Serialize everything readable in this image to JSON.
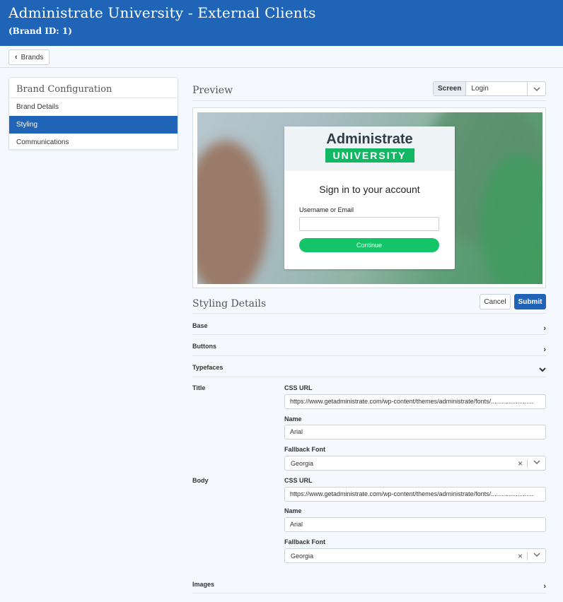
{
  "header": {
    "title": "Administrate University - External Clients",
    "subtitle": "(Brand ID: 1)"
  },
  "topbar": {
    "back_label": "Brands"
  },
  "sidebar": {
    "title": "Brand Configuration",
    "items": [
      {
        "label": "Brand Details",
        "active": false
      },
      {
        "label": "Styling",
        "active": true
      },
      {
        "label": "Communications",
        "active": false
      }
    ]
  },
  "preview": {
    "title": "Preview",
    "screen_label": "Screen",
    "screen_value": "Login",
    "card": {
      "logo_word": "Administrate",
      "logo_band": "UNIVERSITY",
      "heading": "Sign in to your account",
      "field_label": "Username or Email",
      "button": "Continue"
    }
  },
  "styling": {
    "title": "Styling Details",
    "cancel_label": "Cancel",
    "submit_label": "Submit",
    "sections": {
      "base": "Base",
      "buttons": "Buttons",
      "typefaces": "Typefaces",
      "images": "Images"
    },
    "typefaces": {
      "title": {
        "label": "Title",
        "css_url_label": "CSS URL",
        "css_url": "https://www.getadministrate.com/wp-content/themes/administrate/fonts/........................",
        "name_label": "Name",
        "name": "Arial",
        "fallback_label": "Fallback Font",
        "fallback": "Georgia"
      },
      "body": {
        "label": "Body",
        "css_url_label": "CSS URL",
        "css_url": "https://www.getadministrate.com/wp-content/themes/administrate/fonts/........................",
        "name_label": "Name",
        "name": "Arial",
        "fallback_label": "Fallback Font",
        "fallback": "Georgia"
      }
    }
  },
  "colors": {
    "brand_blue": "#1f64b7",
    "green": "#14c468"
  }
}
